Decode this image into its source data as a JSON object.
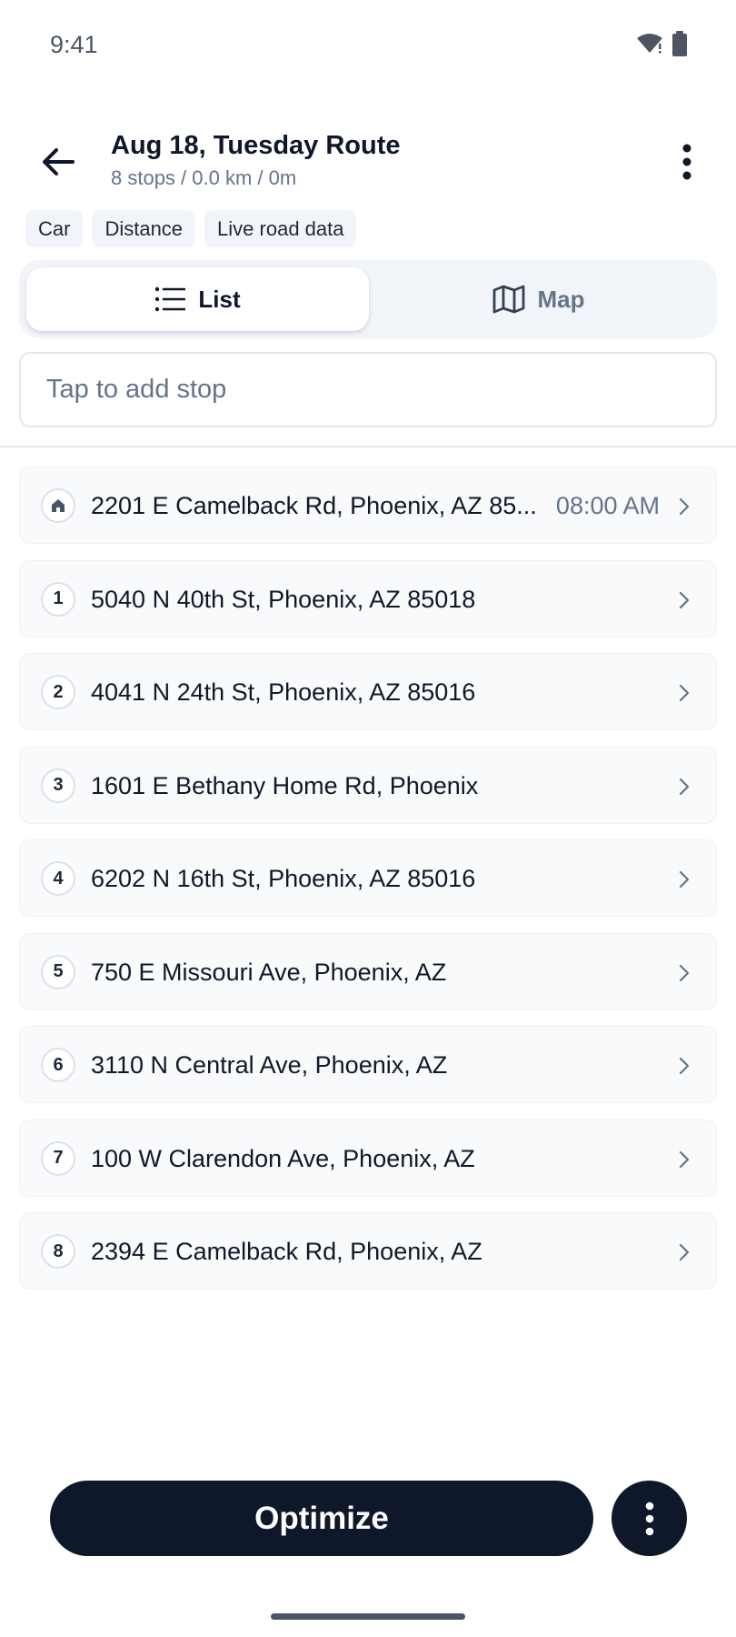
{
  "status_bar": {
    "time": "9:41",
    "icons": [
      "wifi-icon",
      "battery-icon"
    ]
  },
  "header": {
    "title": "Aug 18, Tuesday Route",
    "subtitle": "8 stops / 0.0 km / 0m",
    "icons": [
      "back-arrow-icon",
      "more-vertical-icon"
    ]
  },
  "chips": [
    "Car",
    "Distance",
    "Live road data"
  ],
  "view_toggle": {
    "list_label": "List",
    "map_label": "Map",
    "selected": "List"
  },
  "add_stop": {
    "placeholder": "Tap to add stop"
  },
  "stops": [
    {
      "badge": "",
      "badge_icon": "home-icon",
      "address": "2201 E Camelback Rd, Phoenix, AZ 85...",
      "time": "08:00 AM"
    },
    {
      "badge": "1",
      "address": "5040 N 40th St, Phoenix, AZ 85018",
      "time": ""
    },
    {
      "badge": "2",
      "address": "4041 N 24th St, Phoenix, AZ 85016",
      "time": ""
    },
    {
      "badge": "3",
      "address": "1601 E Bethany Home Rd, Phoenix",
      "time": ""
    },
    {
      "badge": "4",
      "address": "6202 N 16th St, Phoenix, AZ 85016",
      "time": ""
    },
    {
      "badge": "5",
      "address": "750 E Missouri Ave, Phoenix, AZ",
      "time": ""
    },
    {
      "badge": "6",
      "address": "3110 N Central Ave, Phoenix, AZ",
      "time": ""
    },
    {
      "badge": "7",
      "address": "100 W Clarendon Ave, Phoenix, AZ",
      "time": ""
    },
    {
      "badge": "8",
      "address": "2394 E Camelback Rd, Phoenix, AZ",
      "time": ""
    }
  ],
  "footer": {
    "optimize_label": "Optimize"
  },
  "colors": {
    "primary": "#0f172a",
    "muted": "#64748b",
    "surface": "#f8fafc",
    "border": "#e2e8f0"
  }
}
